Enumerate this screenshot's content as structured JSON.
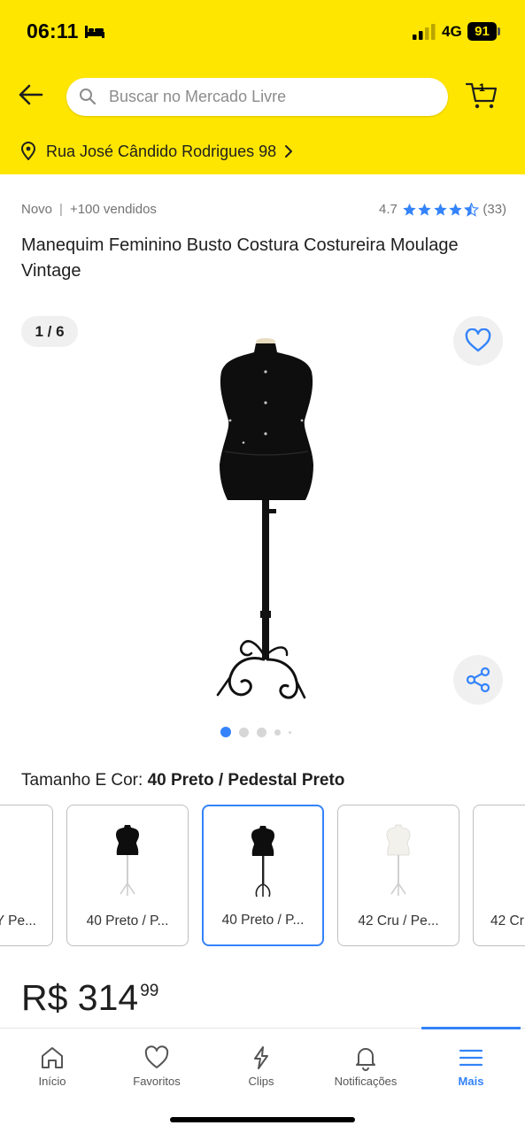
{
  "status_bar": {
    "time": "06:11",
    "network": "4G",
    "battery": "91"
  },
  "header": {
    "search": {
      "placeholder": "Buscar no Mercado Livre",
      "value": ""
    },
    "cart_count": "1",
    "address": "Rua José Cândido Rodrigues 98",
    "background_color": "#ffe600"
  },
  "product": {
    "condition": "Novo",
    "sold": "+100 vendidos",
    "rating_value": "4.7",
    "rating_count": "(33)",
    "rating_stars": 4.7,
    "title": "Manequim Feminino Busto Costura Costureira Moulage Vintage"
  },
  "gallery": {
    "counter": "1 / 6",
    "current_index": 1,
    "total": 6,
    "dots_visible": 5
  },
  "variation": {
    "label": "Tamanho E Cor:",
    "selected": "40 Preto / Pedestal Preto",
    "options": [
      {
        "label": "Y Pe...",
        "color": "black",
        "selected": false
      },
      {
        "label": "40 Preto / P...",
        "color": "black",
        "selected": false
      },
      {
        "label": "40 Preto / P...",
        "color": "black",
        "selected": true
      },
      {
        "label": "42 Cru / Pe...",
        "color": "cream",
        "selected": false
      },
      {
        "label": "42 Cr",
        "color": "cream",
        "selected": false
      }
    ]
  },
  "price": {
    "currency": "R$",
    "integer": "R$ 314",
    "cents": "99"
  },
  "tabbar": {
    "tabs": [
      {
        "label": "Início",
        "icon": "home-icon",
        "active": false
      },
      {
        "label": "Favoritos",
        "icon": "heart-icon",
        "active": false
      },
      {
        "label": "Clips",
        "icon": "lightning-icon",
        "active": false
      },
      {
        "label": "Notificações",
        "icon": "bell-icon",
        "active": false
      },
      {
        "label": "Mais",
        "icon": "menu-icon",
        "active": true
      }
    ]
  },
  "colors": {
    "accent_blue": "#3483fa",
    "yellow": "#ffe600"
  }
}
